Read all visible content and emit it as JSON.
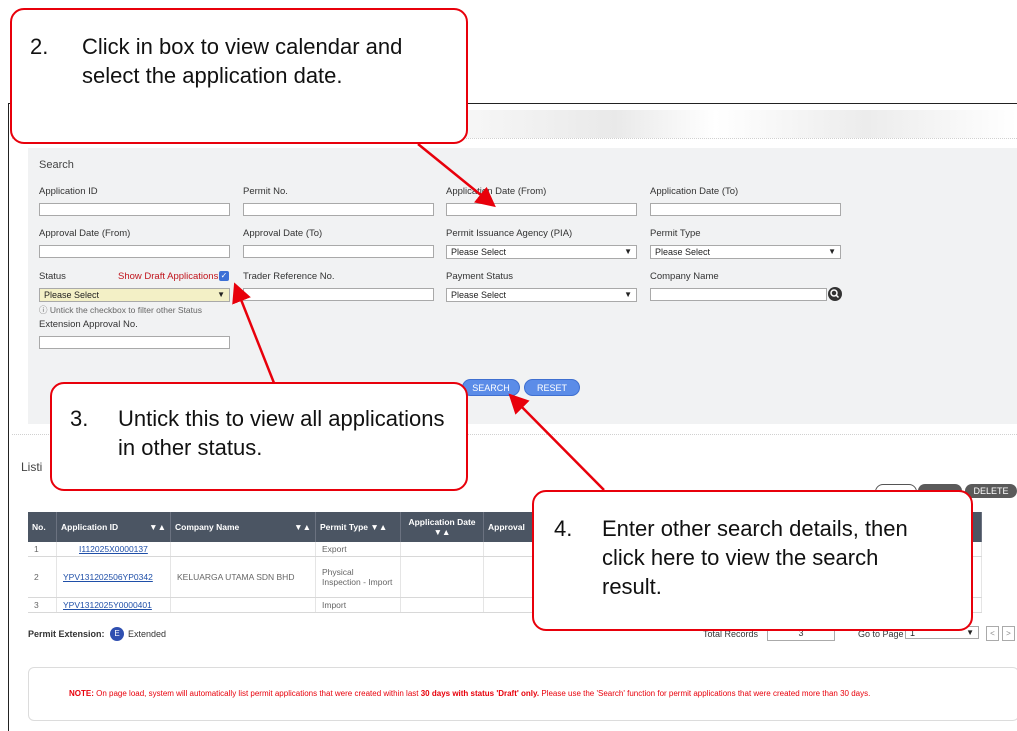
{
  "callouts": {
    "c2": {
      "num": "2.",
      "text": "Click in box to view calendar and select the application date."
    },
    "c3": {
      "num": "3.",
      "text": "Untick this to view all applications in other status."
    },
    "c4": {
      "num": "4.",
      "text": "Enter other search details, then click here to view the search result."
    }
  },
  "search": {
    "title": "Search",
    "application_id_label": "Application ID",
    "permit_no_label": "Permit No.",
    "app_date_from_label": "Application Date (From)",
    "app_date_to_label": "Application Date (To)",
    "approval_date_from_label": "Approval Date (From)",
    "approval_date_to_label": "Approval Date (To)",
    "pia_label": "Permit Issuance Agency (PIA)",
    "pia_value": "Please Select",
    "permit_type_label": "Permit Type",
    "permit_type_value": "Please Select",
    "status_label": "Status",
    "show_draft_label": "Show Draft Applications",
    "status_value": "Please Select",
    "untick_hint": "Untick the checkbox to filter other Status",
    "trader_ref_label": "Trader Reference No.",
    "payment_status_label": "Payment Status",
    "payment_status_value": "Please Select",
    "company_name_label": "Company Name",
    "extension_label": "Extension Approval No.",
    "search_button": "SEARCH",
    "reset_button": "RESET"
  },
  "listing": {
    "title_partial": "Listi",
    "delete_button": "DELETE"
  },
  "table": {
    "headers": [
      "No.",
      "Application ID",
      "Company Name",
      "Permit Type",
      "Application Date",
      "Approval"
    ],
    "rows": [
      {
        "no": "1",
        "app_id": "I112025X0000137",
        "company": "",
        "permit_type": "Export"
      },
      {
        "no": "2",
        "app_id": "YPV131202506YP0342",
        "company": "KELUARGA UTAMA SDN BHD",
        "permit_type": "Physical Inspection - Import"
      },
      {
        "no": "3",
        "app_id": "YPV1312025Y0000401",
        "company": "",
        "permit_type": "Import"
      }
    ]
  },
  "footer": {
    "permit_extension_label": "Permit Extension:",
    "extended_badge": "E",
    "extended_label": "Extended",
    "total_records_label": "Total Records",
    "total_records_value": "3",
    "go_to_page_label": "Go to Page",
    "page_value": "1",
    "note_prefix": "NOTE:",
    "note_text_1": "On page load, system will automatically list permit applications that were created within last",
    "note_bold": "30 days with status 'Draft' only.",
    "note_text_2": "Please use the 'Search' function for permit applications that were created more than 30 days."
  },
  "colors": {
    "callout_border": "#e8000b",
    "table_header": "#4b5563",
    "button_blue": "#5b8ce8",
    "note_red": "#e8000b"
  }
}
